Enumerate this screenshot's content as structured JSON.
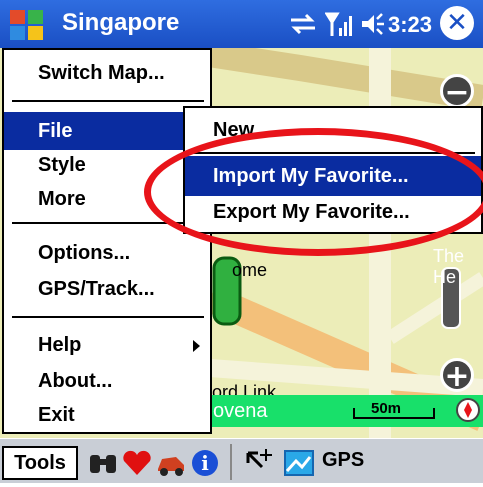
{
  "window": {
    "title": "Singapore",
    "clock": "3:23",
    "close": "✕"
  },
  "menu": {
    "items": [
      "Switch Map...",
      "File",
      "Style",
      "More",
      "Options...",
      "GPS/Track...",
      "Help",
      "About...",
      "Exit"
    ],
    "selected": "File"
  },
  "submenu": {
    "items": [
      "New...",
      "Import My Favorite...",
      "Export My Favorite..."
    ],
    "selected": "Import My Favorite..."
  },
  "map": {
    "street_name": "ovena",
    "link_label": "ord Link",
    "road_label": "ome",
    "place_label": "The He",
    "scale": "50m",
    "zoom_in": "+",
    "zoom_out": "−"
  },
  "toolbar": {
    "tools_label": "Tools",
    "icons": [
      "binoculars-icon",
      "heart-icon",
      "car-icon",
      "info-icon",
      "arrow-pointer-icon",
      "gps-icon"
    ],
    "info_label": "i",
    "gps_label": "GPS"
  },
  "colors": {
    "selection": "#0a2ca0",
    "titlebar": "#1a4fc4",
    "highlight_circle": "#e8141a",
    "map_bg": "#ecedb8",
    "scalebar": "#18e06a"
  }
}
